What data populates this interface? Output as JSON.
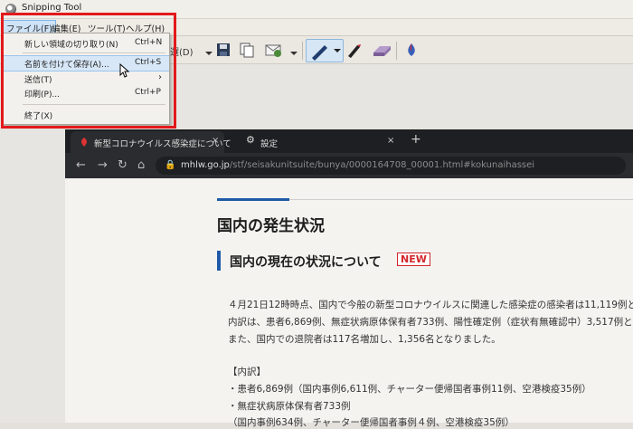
{
  "app": {
    "title": "Snipping Tool"
  },
  "menubar": {
    "items": [
      "ファイル(F)",
      "編集(E)",
      "ツール(T)",
      "ヘルプ(H)"
    ]
  },
  "toolbar": {
    "mode_label_partial": "選(D)"
  },
  "file_menu": {
    "items": [
      {
        "label": "新しい領域の切り取り(N)",
        "shortcut": "Ctrl+N"
      },
      {
        "label": "名前を付けて保存(A)...",
        "shortcut": "Ctrl+S"
      },
      {
        "label": "送信(T)",
        "shortcut": "›"
      },
      {
        "label": "印刷(P)...",
        "shortcut": "Ctrl+P"
      },
      {
        "label": "終了(X)",
        "shortcut": ""
      }
    ]
  },
  "browser": {
    "tabs": [
      {
        "label": "新型コロナウイルス感染症について",
        "close": "×"
      },
      {
        "label": "設定",
        "close": "×"
      }
    ],
    "new_tab": "+",
    "url_host": "mhlw.go.jp",
    "url_path": "/stf/seisakunitsuite/bunya/0000164708_00001.html#kokunaihassei"
  },
  "page": {
    "heading": "国内の発生状況",
    "subheading": "国内の現在の状況について",
    "badge": "NEW",
    "lines": [
      "４月21日12時時点、国内で今般の新型コロナウイルスに関連した感染症の感染者は11,119例と",
      "内訳は、患者6,869例、無症状病原体保有者733例、陽性確定例（症状有無確認中）3,517例と",
      "また、国内での退院者は117名増加し、1,356名となりました。",
      "【内訳】",
      "・患者6,869例（国内事例6,611例、チャーター便帰国者事例11例、空港検疫35例）",
      "・無症状病原体保有者733例",
      "（国内事例634例、チャーター便帰国者事例４例、空港検疫35例）"
    ]
  },
  "colors": {
    "highlight_box": "#e2191b",
    "accent": "#1e5aa8",
    "new_badge": "#d2262a"
  }
}
